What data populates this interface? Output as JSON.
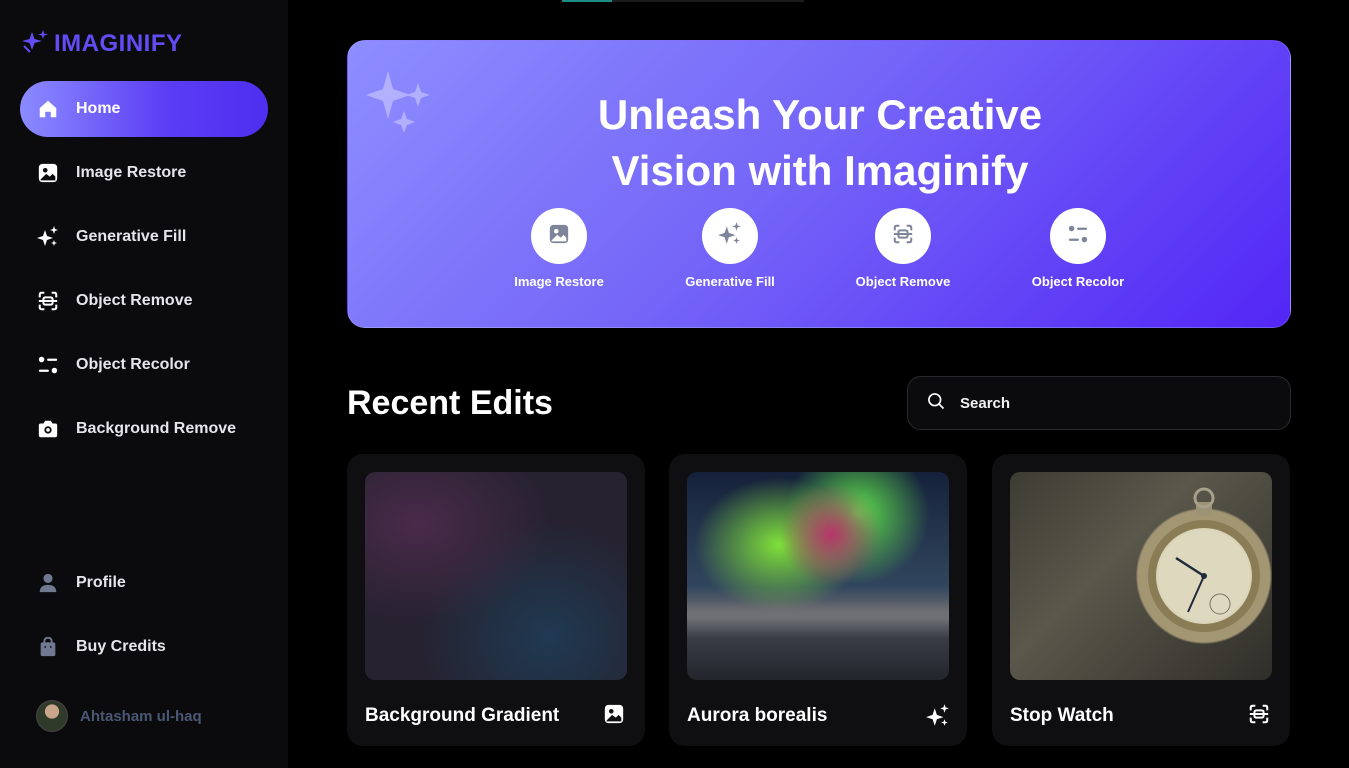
{
  "brand": {
    "name": "IMAGINIFY",
    "color": "#624cf5"
  },
  "sidebar": {
    "items": [
      {
        "label": "Home",
        "icon": "home-icon",
        "active": true
      },
      {
        "label": "Image Restore",
        "icon": "image-icon"
      },
      {
        "label": "Generative Fill",
        "icon": "stars-icon"
      },
      {
        "label": "Object Remove",
        "icon": "scan-icon"
      },
      {
        "label": "Object Recolor",
        "icon": "filter-icon"
      },
      {
        "label": "Background Remove",
        "icon": "camera-icon"
      }
    ],
    "bottom_items": [
      {
        "label": "Profile",
        "icon": "profile-icon"
      },
      {
        "label": "Buy Credits",
        "icon": "bag-icon"
      }
    ],
    "user": {
      "name": "Ahtasham ul-haq"
    }
  },
  "hero": {
    "title_line1": "Unleash Your Creative",
    "title_line2": "Vision with Imaginify",
    "tools": [
      {
        "label": "Image Restore",
        "icon": "image-icon"
      },
      {
        "label": "Generative Fill",
        "icon": "stars-icon"
      },
      {
        "label": "Object Remove",
        "icon": "scan-icon"
      },
      {
        "label": "Object Recolor",
        "icon": "filter-icon"
      }
    ]
  },
  "recent": {
    "title": "Recent Edits",
    "search_placeholder": "Search",
    "cards": [
      {
        "title": "Background Gradient",
        "icon": "image-icon"
      },
      {
        "title": "Aurora borealis",
        "icon": "stars-icon"
      },
      {
        "title": "Stop Watch",
        "icon": "scan-icon"
      }
    ]
  }
}
